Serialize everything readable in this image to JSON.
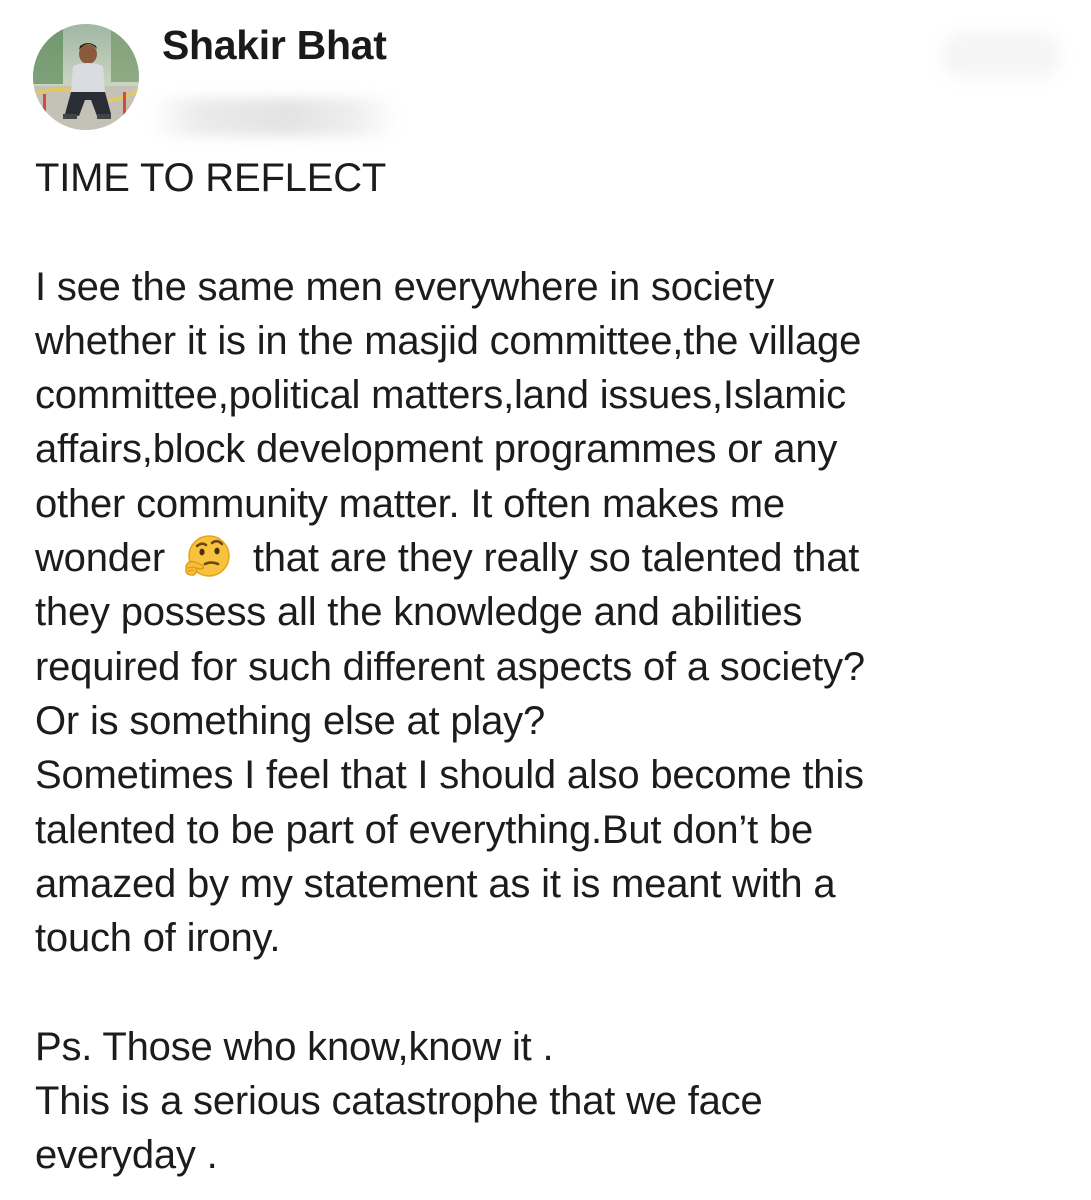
{
  "author": {
    "name": "Shakir Bhat"
  },
  "post": {
    "title": "TIME TO REFLECT",
    "lines": [
      "I see the same men everywhere in society",
      "whether it is in the masjid committee,the village",
      "committee,political matters,land issues,Islamic",
      "affairs,block development programmes or any",
      "other community matter. It often makes me"
    ],
    "emoji_line": {
      "before": "wonder",
      "emoji": "thinking-face",
      "after": "that are they really so talented that"
    },
    "lines_after": [
      "they possess all the knowledge and abilities",
      "required for such different aspects of a society?",
      "Or is something else at play?",
      "Sometimes I feel that I should also become this",
      "talented to be part of everything.But don’t be",
      "amazed by my statement as it is meant with a",
      "touch of irony."
    ],
    "ps_lines": [
      "Ps. Those who know,know it .",
      "This is a serious catastrophe that we face",
      "everyday ."
    ]
  },
  "icons": {
    "avatar": "profile-photo",
    "emoji": "thinking-face-emoji"
  },
  "colors": {
    "text": "#1c1c1c",
    "background": "#ffffff"
  }
}
